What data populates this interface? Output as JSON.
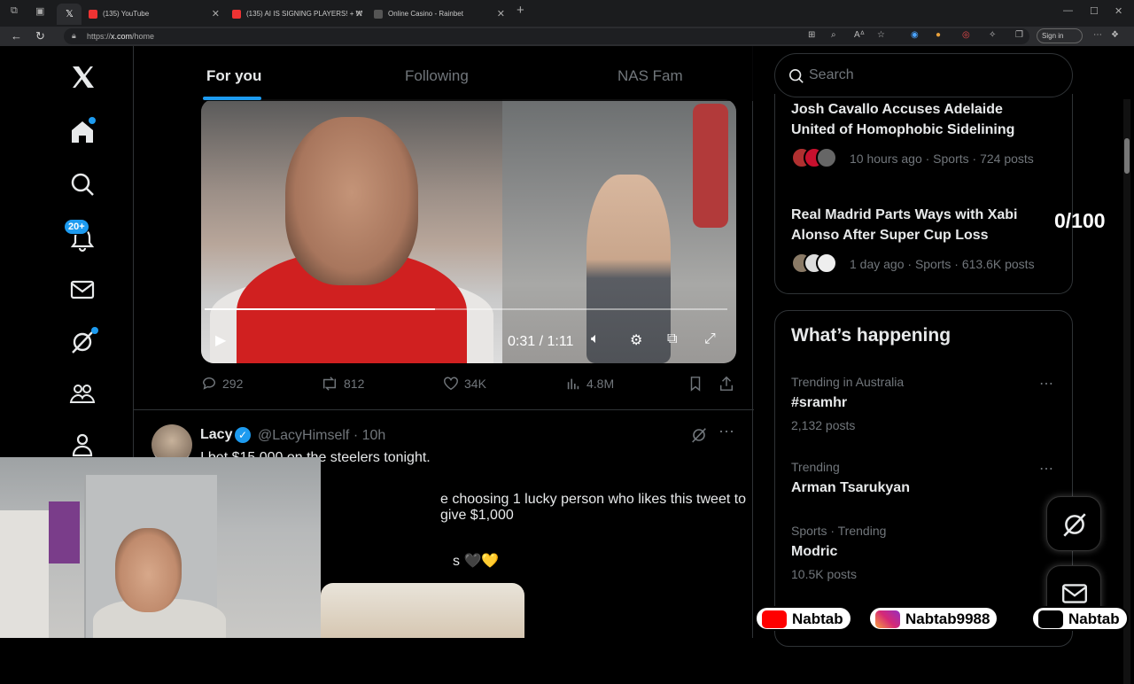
{
  "browser": {
    "tabs": [
      {
        "label": "(135) YouTube"
      },
      {
        "label": "(135) AI IS SIGNING PLAYERS! + W"
      },
      {
        "label": "Online Casino - Rainbet"
      }
    ],
    "new_tab": "+",
    "url_prefix": "https://",
    "url_host": "x.com",
    "url_path": "/home",
    "sign_in": "Sign in"
  },
  "feed": {
    "tabs": [
      "For you",
      "Following",
      "NAS Fam"
    ],
    "notification_badge": "20+",
    "video": {
      "time": "0:31 / 1:11",
      "progress_fraction": 0.44
    },
    "stats": {
      "replies": "292",
      "reposts": "812",
      "likes": "34K",
      "views": "4.8M"
    },
    "tweet": {
      "name": "Lacy",
      "handle": "@LacyHimself · 10h",
      "line1": "I bet $15,000 on the steelers tonight.",
      "line2": "e choosing 1 lucky person who likes this tweet to give $1,000",
      "line3": "s 🖤💛"
    }
  },
  "sidebar": {
    "search_placeholder": "Search",
    "news": [
      {
        "title": "Josh Cavallo Accuses Adelaide United of Homophobic Sidelining",
        "meta": "10 hours ago · Sports · 724 posts"
      },
      {
        "title": "Real Madrid Parts Ways with Xabi Alonso After Super Cup Loss",
        "meta": "1 day ago · Sports · 613.6K posts"
      }
    ],
    "whats_happening": "What’s happening",
    "trends": [
      {
        "context": "Trending in Australia",
        "name": "#sramhr",
        "posts": "2,132 posts"
      },
      {
        "context": "Trending",
        "name": "Arman Tsarukyan",
        "posts": ""
      },
      {
        "context": "Sports · Trending",
        "name": "Modric",
        "posts": "10.5K posts"
      }
    ]
  },
  "overlay": {
    "counter": "0/100",
    "socials": [
      {
        "platform": "youtube",
        "handle": "Nabtab"
      },
      {
        "platform": "instagram",
        "handle": "Nabtab9988"
      },
      {
        "platform": "tiktok",
        "handle": "Nabtab"
      }
    ]
  },
  "colors": {
    "accent": "#1d9bf0",
    "bg": "#000000",
    "muted": "#71767b",
    "border": "#2f3336"
  }
}
